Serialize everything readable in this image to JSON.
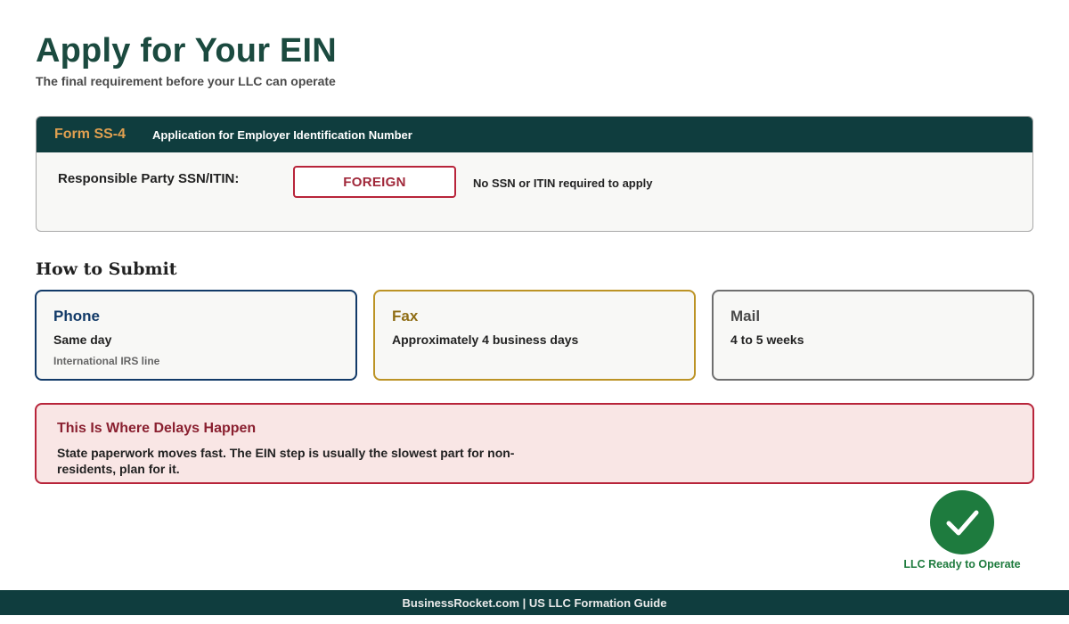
{
  "header": {
    "title": "Apply for Your EIN",
    "subtitle": "The final requirement before your LLC can operate"
  },
  "form": {
    "id": "Form SS-4",
    "description": "Application for Employer Identification Number",
    "field_label": "Responsible Party SSN/ITIN:",
    "field_value": "FOREIGN",
    "field_note": "No SSN or ITIN required to apply"
  },
  "submit": {
    "heading": "How to Submit",
    "methods": [
      {
        "title": "Phone",
        "time": "Same day",
        "note": "International IRS line",
        "color": "#123a68"
      },
      {
        "title": "Fax",
        "time": "Approximately 4 business days",
        "note": "",
        "color": "#bc9325"
      },
      {
        "title": "Mail",
        "time": "4 to 5 weeks",
        "note": "",
        "color": "#6f6f6f"
      }
    ]
  },
  "alert": {
    "title": "This Is Where Delays Happen",
    "text": "State paperwork moves fast. The EIN step is usually the slowest part for non-residents, plan for it."
  },
  "status": {
    "icon": "checkmark-icon",
    "label": "LLC Ready to Operate"
  },
  "footer": {
    "text": "BusinessRocket.com | US LLC Formation Guide"
  },
  "colors": {
    "primary": "#0f3d3e",
    "title": "#1b4a3f",
    "accent_orange": "#e0a050",
    "alert_red": "#b8243a",
    "success_green": "#1e7b3e"
  }
}
